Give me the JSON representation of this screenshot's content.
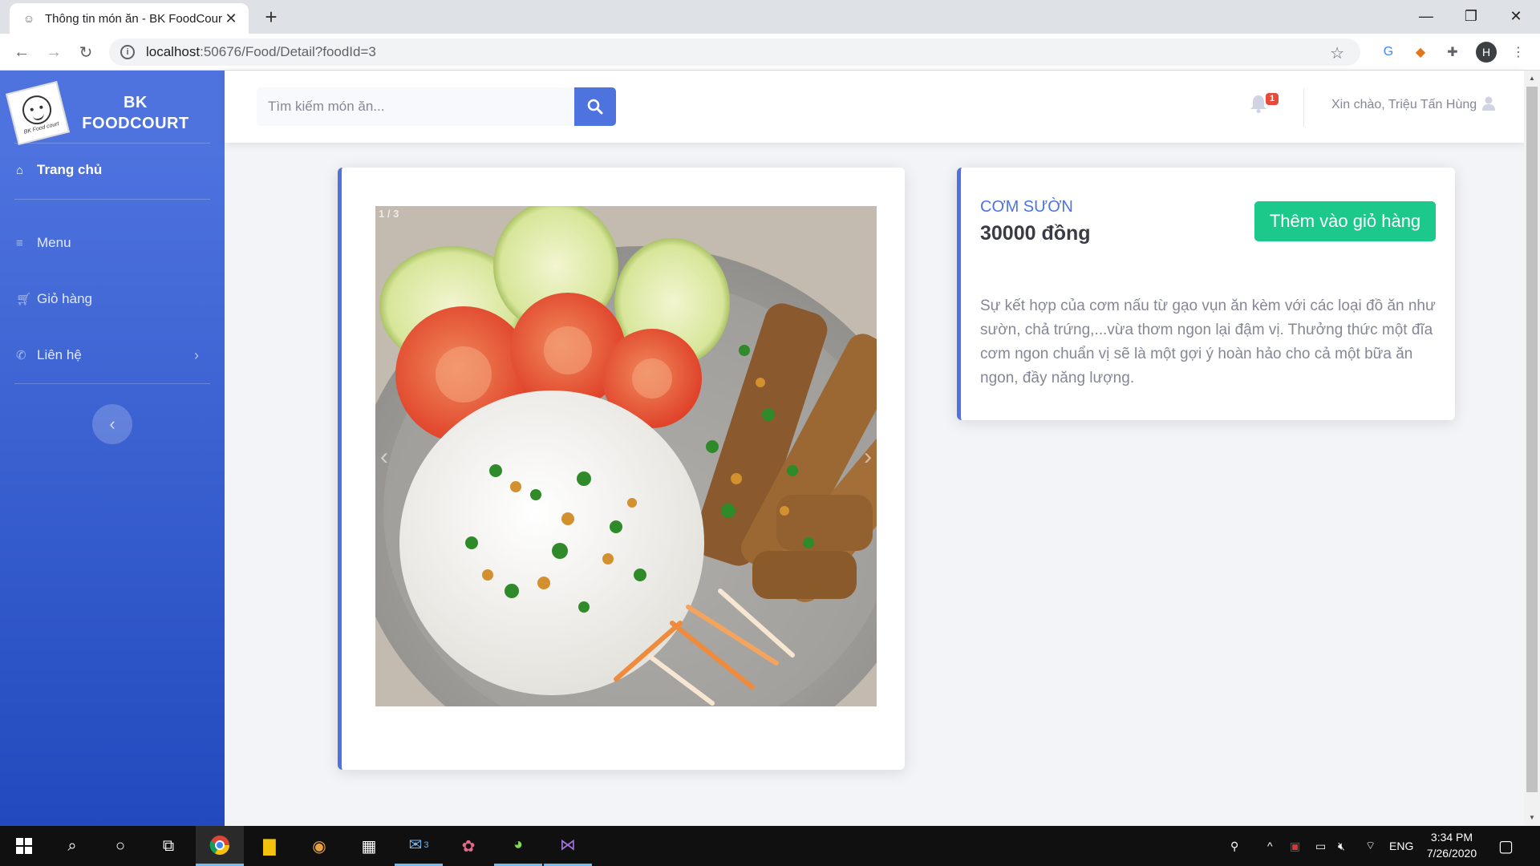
{
  "browser": {
    "tab_title": "Thông tin món ăn - BK FoodCour",
    "url_host": "localhost",
    "url_path": ":50676/Food/Detail?foodId=3",
    "profile_initial": "H"
  },
  "sidebar": {
    "brand_line1": "BK",
    "brand_line2": "FOODCOURT",
    "logo_text": "BK Food court",
    "items": [
      {
        "label": "Trang chủ",
        "icon": "home-icon"
      },
      {
        "label": "Menu",
        "icon": "menu-icon"
      },
      {
        "label": "Giỏ hàng",
        "icon": "cart-icon"
      },
      {
        "label": "Liên hệ",
        "icon": "phone-icon"
      }
    ]
  },
  "topbar": {
    "search_placeholder": "Tìm kiếm món ăn...",
    "notification_count": "1",
    "greeting": "Xin chào, Triệu Tấn Hùng"
  },
  "food": {
    "name": "Cơm sườn",
    "price": "30000 đồng",
    "add_to_cart": "Thêm vào giỏ hàng",
    "description": "Sự kết hợp của cơm nấu từ gạo vụn ăn kèm với các loại đồ ăn như sườn, chả trứng,...vừa thơm ngon lại đậm vị. Thưởng thức một đĩa cơm ngon chuẩn vị sẽ là một gợi ý hoàn hảo cho cả một bữa ăn ngon, đầy năng lượng.",
    "carousel_counter": "1 / 3"
  },
  "taskbar": {
    "mail_badge": "3",
    "lang": "ENG",
    "time": "3:34 PM",
    "date": "7/26/2020"
  },
  "colors": {
    "primary": "#4e73df",
    "success": "#1cc88a",
    "danger": "#e74a3b"
  }
}
